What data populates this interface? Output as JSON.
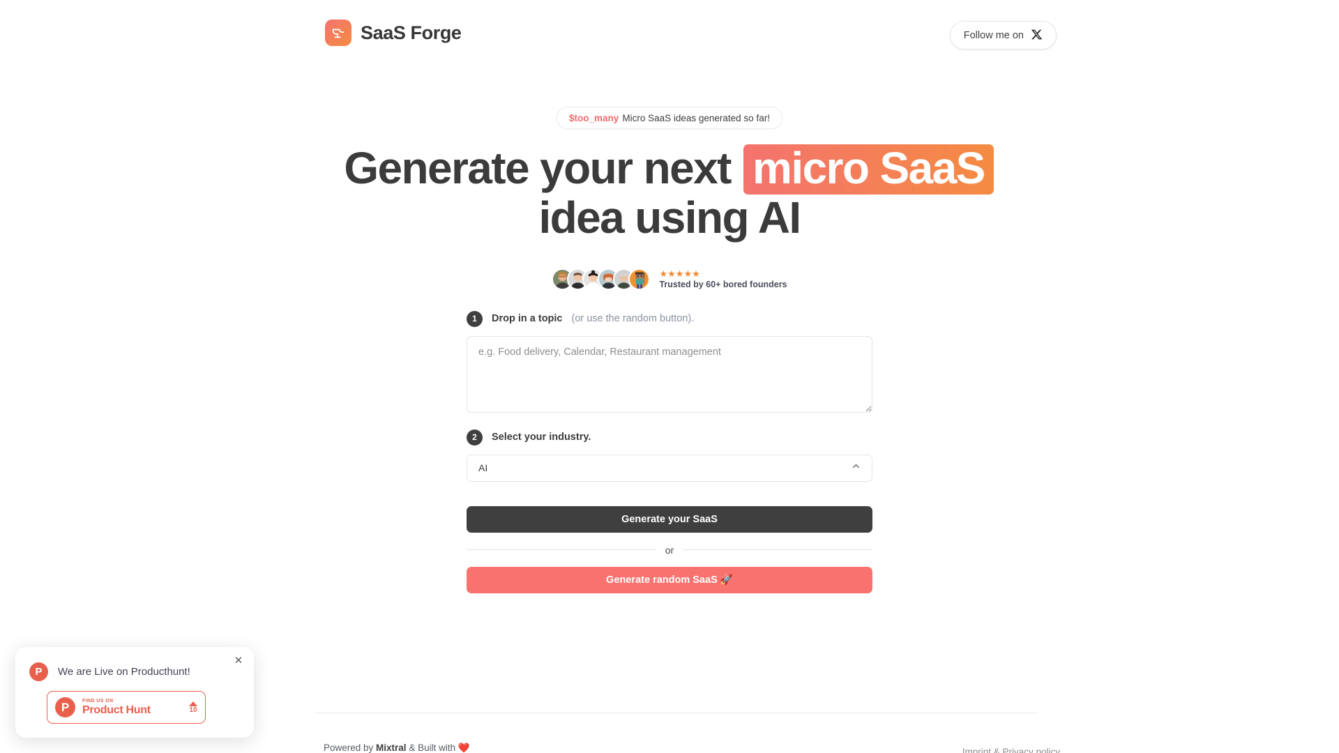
{
  "header": {
    "brand_name": "SaaS Forge",
    "brand_logo_icon": "anvil-icon",
    "follow_label": "Follow me on",
    "follow_icon": "x-twitter-icon"
  },
  "hero": {
    "counter_value": "$too_many",
    "counter_text": "Micro SaaS ideas generated so far!",
    "headline_part1": "Generate your next",
    "headline_highlight": "micro SaaS",
    "headline_part2": "idea using AI",
    "stars": "★★★★★",
    "trusted_text": "Trusted by 60+ bored founders",
    "avatar_count": 6,
    "gradient_start": "#f4736f",
    "gradient_end": "#f58b42"
  },
  "form": {
    "step1_num": "1",
    "step1_label": "Drop in a topic",
    "step1_hint": "(or use the random button).",
    "topic_placeholder": "e.g. Food delivery, Calendar, Restaurant management",
    "topic_value": "",
    "step2_num": "2",
    "step2_label": "Select your industry.",
    "industry_value": "AI",
    "industry_chevron_icon": "chevron-up-icon",
    "generate_label": "Generate your SaaS",
    "or_label": "or",
    "random_label": "Generate random SaaS 🚀"
  },
  "producthunt": {
    "close_icon": "close-icon",
    "logo_letter": "P",
    "title": "We are Live on Producthunt!",
    "badge_find_us_on": "FIND US ON",
    "badge_name": "Product Hunt",
    "badge_logo_letter": "P",
    "upvote_count": "10",
    "accent_color": "#e8604c"
  },
  "footer": {
    "powered_prefix": "Powered by ",
    "powered_brand": "Mixtral",
    "powered_suffix": " & Built with ❤️",
    "legal_link": "Imprint & Privacy policy"
  }
}
